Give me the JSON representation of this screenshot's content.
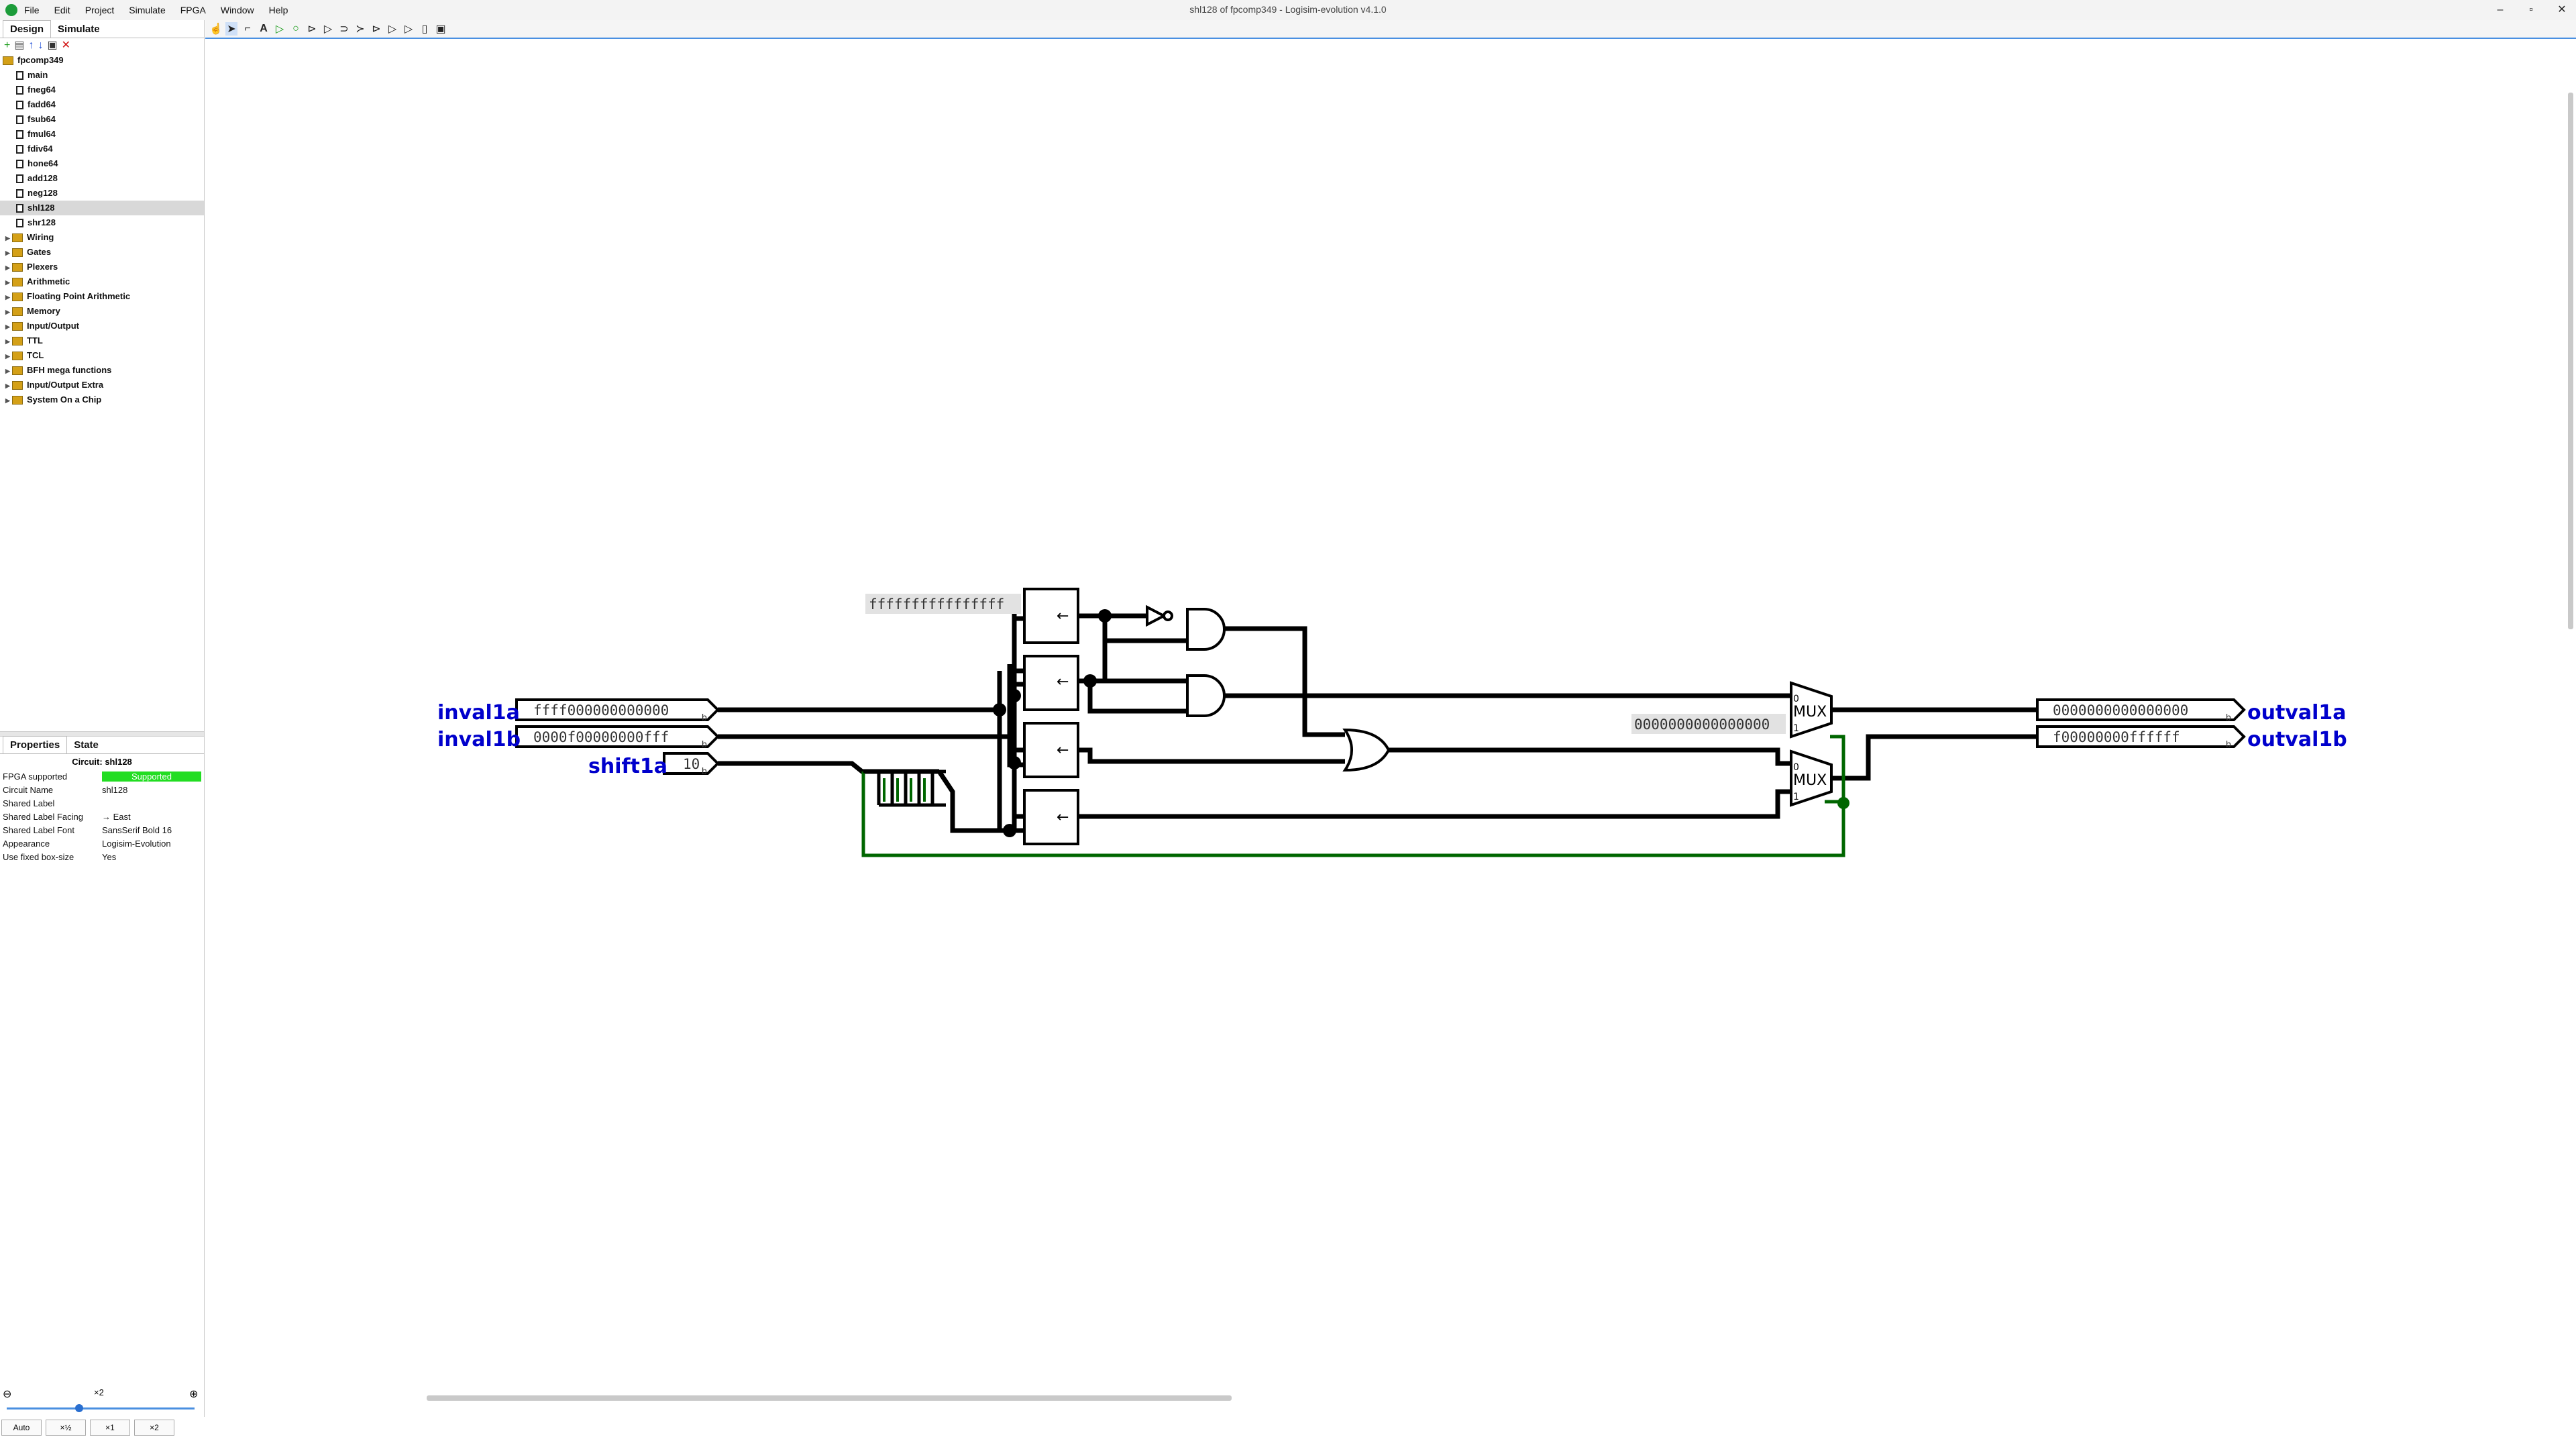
{
  "window": {
    "title": "shl128 of fpcomp349 - Logisim-evolution v4.1.0",
    "controls": {
      "minimize": "–",
      "maximize": "▫",
      "close": "✕"
    }
  },
  "menu": [
    "File",
    "Edit",
    "Project",
    "Simulate",
    "FPGA",
    "Window",
    "Help"
  ],
  "left_tabs": {
    "design": "Design",
    "simulate": "Simulate"
  },
  "tree": {
    "project": "fpcomp349",
    "circuits": [
      "main",
      "fneg64",
      "fadd64",
      "fsub64",
      "fmul64",
      "fdiv64",
      "hone64",
      "add128",
      "neg128",
      "shl128",
      "shr128"
    ],
    "selected": "shl128",
    "libraries": [
      "Wiring",
      "Gates",
      "Plexers",
      "Arithmetic",
      "Floating Point Arithmetic",
      "Memory",
      "Input/Output",
      "TTL",
      "TCL",
      "BFH mega functions",
      "Input/Output Extra",
      "System On a Chip"
    ]
  },
  "properties": {
    "tabs": {
      "properties": "Properties",
      "state": "State"
    },
    "title": "Circuit: shl128",
    "rows": [
      {
        "key": "FPGA supported",
        "value": "Supported"
      },
      {
        "key": "Circuit Name",
        "value": "shl128"
      },
      {
        "key": "Shared Label",
        "value": ""
      },
      {
        "key": "Shared Label Facing",
        "value": "→ East"
      },
      {
        "key": "Shared Label Font",
        "value": "SansSerif Bold 16"
      },
      {
        "key": "Appearance",
        "value": "Logisim-Evolution"
      },
      {
        "key": "Use fixed box-size",
        "value": "Yes"
      }
    ]
  },
  "zoom": {
    "label": "×2",
    "buttons": [
      "Auto",
      "×½",
      "×1",
      "×2"
    ]
  },
  "circuit": {
    "inputs": [
      {
        "label": "inval1a",
        "value": "ffff000000000000"
      },
      {
        "label": "inval1b",
        "value": "0000f00000000fff"
      },
      {
        "label": "shift1a",
        "value": "10"
      }
    ],
    "outputs": [
      {
        "label": "outval1a",
        "value": "0000000000000000"
      },
      {
        "label": "outval1b",
        "value": "f00000000ffffff"
      }
    ],
    "constants": {
      "top": "ffffffffffffffff",
      "mux": "0000000000000000"
    },
    "mux_label": "MUX",
    "shift_symbol": "←",
    "bit_mark": "b",
    "mux_inputs": [
      "0",
      "1"
    ]
  }
}
